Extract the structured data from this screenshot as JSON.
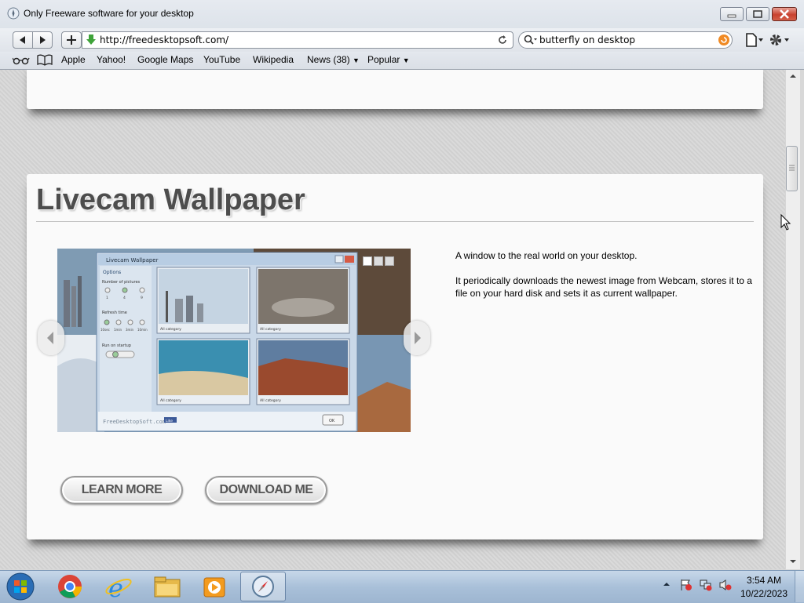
{
  "window": {
    "title": "Only Freeware software for your desktop"
  },
  "toolbar": {
    "url": "http://freedesktopsoft.com/",
    "search_value": "butterfly on desktop"
  },
  "bookmarks": {
    "items": [
      {
        "label": "Apple"
      },
      {
        "label": "Yahoo!"
      },
      {
        "label": "Google Maps"
      },
      {
        "label": "YouTube"
      },
      {
        "label": "Wikipedia"
      },
      {
        "label": "News (38)"
      },
      {
        "label": "Popular"
      }
    ]
  },
  "main": {
    "heading": "Livecam Wallpaper",
    "description_1": "A window to the real world on your desktop.",
    "description_2": "It periodically downloads the newest image from Webcam, stores it to a file on your hard disk and sets it as current wallpaper.",
    "learn_more_label": "LEARN MORE",
    "download_label": "DOWNLOAD ME",
    "slider_pages": 3,
    "slider_active_page": 1
  },
  "screenshot_app": {
    "title": "Livecam Wallpaper",
    "options_header": "Options",
    "num_pictures_label": "Number of pictures",
    "num_pictures_options": [
      "1",
      "4",
      "9"
    ],
    "refresh_label": "Refresh time",
    "refresh_options": [
      "10sec",
      "1min",
      "3min",
      "10min"
    ],
    "run_startup_label": "Run on startup",
    "footer_brand": "FreeDesktopSoft.com",
    "like_label": "Like",
    "ok_label": "OK",
    "tile_category": "All category"
  },
  "taskbar": {
    "time": "3:54 AM",
    "date": "10/22/2023"
  },
  "colors": {
    "heading": "#4d4d4d",
    "taskbar": "#a9c0d9",
    "close_button": "#c8412e"
  }
}
